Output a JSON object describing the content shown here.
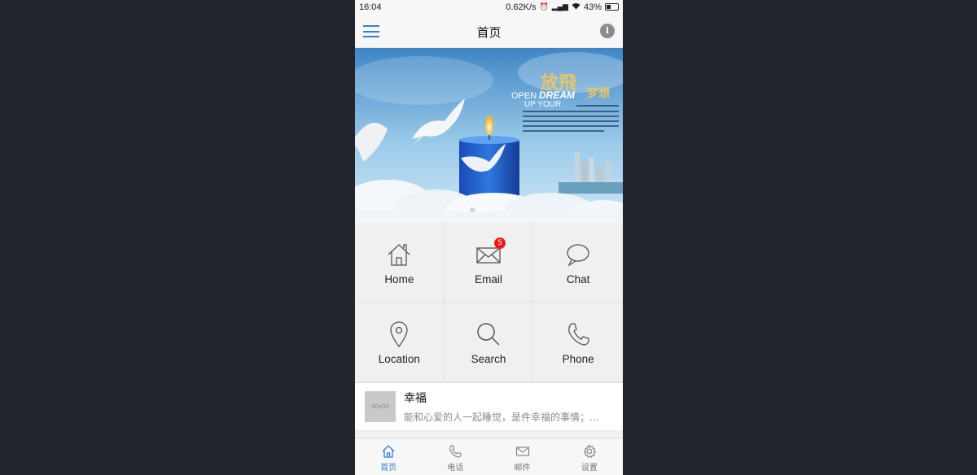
{
  "status_bar": {
    "time": "16:04",
    "net_speed": "0.62K/s",
    "battery": "43%"
  },
  "header": {
    "title": "首页",
    "info_icon": "i"
  },
  "banner": {
    "headline": "放飛",
    "headline_2": "梦想",
    "open_text": "OPEN",
    "dream_text": "DREAM",
    "up_text": "UP YOUR",
    "slides": 4,
    "active_slide": 1
  },
  "grid": [
    {
      "label": "Home",
      "icon": "home-icon"
    },
    {
      "label": "Email",
      "icon": "mail-icon",
      "badge": "5"
    },
    {
      "label": "Chat",
      "icon": "chat-bubble-icon"
    },
    {
      "label": "Location",
      "icon": "location-pin-icon"
    },
    {
      "label": "Search",
      "icon": "search-icon"
    },
    {
      "label": "Phone",
      "icon": "phone-icon"
    }
  ],
  "list": [
    {
      "thumb": "40x30",
      "title": "幸福",
      "desc": "能和心爱的人一起睡觉，是件幸福的事情；..."
    }
  ],
  "tabbar": [
    {
      "label": "首页",
      "icon": "home-icon",
      "active": true
    },
    {
      "label": "电话",
      "icon": "phone-icon",
      "active": false
    },
    {
      "label": "邮件",
      "icon": "mail-icon",
      "active": false
    },
    {
      "label": "设置",
      "icon": "gear-icon",
      "active": false
    }
  ],
  "colors": {
    "accent": "#2f80d8",
    "badge": "#f01a1a",
    "background": "#22252e"
  }
}
